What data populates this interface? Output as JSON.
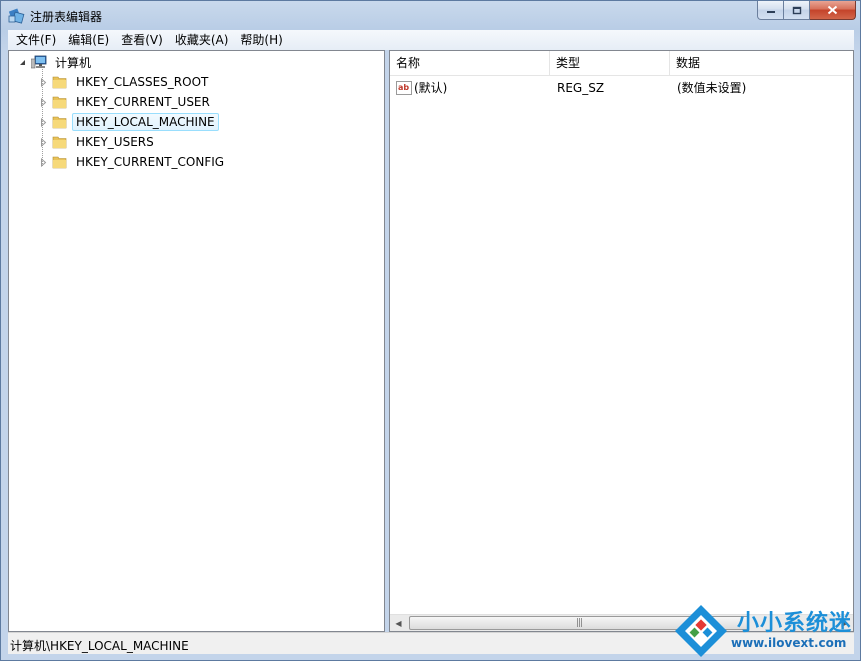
{
  "window": {
    "title": "注册表编辑器"
  },
  "menu": [
    {
      "label": "文件(F)"
    },
    {
      "label": "编辑(E)"
    },
    {
      "label": "查看(V)"
    },
    {
      "label": "收藏夹(A)"
    },
    {
      "label": "帮助(H)"
    }
  ],
  "tree": {
    "root": "计算机",
    "nodes": [
      {
        "label": "HKEY_CLASSES_ROOT",
        "selected": false
      },
      {
        "label": "HKEY_CURRENT_USER",
        "selected": false
      },
      {
        "label": "HKEY_LOCAL_MACHINE",
        "selected": true
      },
      {
        "label": "HKEY_USERS",
        "selected": false
      },
      {
        "label": "HKEY_CURRENT_CONFIG",
        "selected": false
      }
    ]
  },
  "list": {
    "columns": [
      "名称",
      "类型",
      "数据"
    ],
    "rows": [
      {
        "name": "(默认)",
        "type": "REG_SZ",
        "data": "(数值未设置)",
        "icon": "string-value-icon"
      }
    ]
  },
  "status": {
    "path": "计算机\\HKEY_LOCAL_MACHINE"
  },
  "watermark": {
    "brand": "小小系统迷",
    "url": "www.ilovext.com"
  },
  "colors": {
    "frame": "#c3d4ea",
    "selection_border": "#99defd",
    "close_button": "#c4432a",
    "watermark_blue": "#1c8fd8"
  }
}
